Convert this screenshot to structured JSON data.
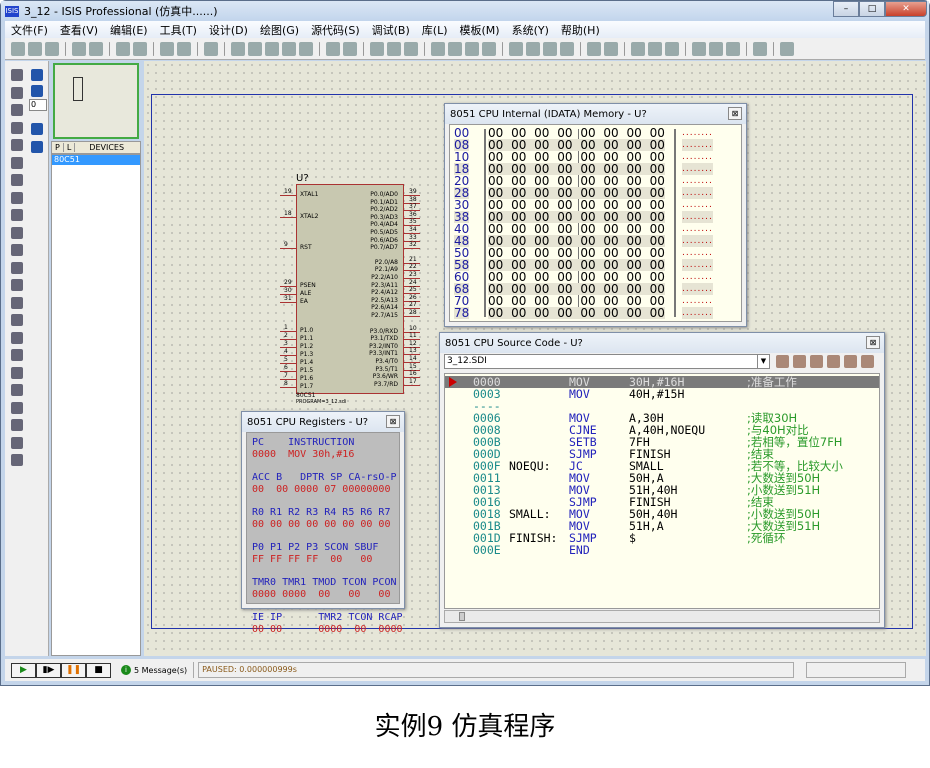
{
  "window": {
    "title": "3_12 - ISIS Professional (仿真中......)",
    "app_icon": "ISIS",
    "min": "–",
    "max": "□",
    "close": "✕"
  },
  "menu": [
    "文件(F)",
    "查看(V)",
    "编辑(E)",
    "工具(T)",
    "设计(D)",
    "绘图(G)",
    "源代码(S)",
    "调试(B)",
    "库(L)",
    "模板(M)",
    "系统(Y)",
    "帮助(H)"
  ],
  "toolbar_icons": [
    "new",
    "open",
    "save",
    "import",
    "export",
    "print",
    "print-area",
    "refresh",
    "grid",
    "origin",
    "pan",
    "zoom-in",
    "zoom-out",
    "zoom-all",
    "zoom-area",
    "undo",
    "redo",
    "cut",
    "copy",
    "paste",
    "block-copy",
    "block-move",
    "block-rotate",
    "block-delete",
    "pick",
    "make-device",
    "package",
    "decompose",
    "wire-autoroute",
    "search",
    "property-assign",
    "new-sheet",
    "remove-sheet",
    "goto-sheet",
    "export-netlist",
    "bill-of-materials",
    "electrical-check",
    "ares"
  ],
  "left_tools": {
    "rotate_value": "0"
  },
  "devices": {
    "tab_p": "P",
    "tab_l": "L",
    "header": "DEVICES",
    "items": [
      "80C51"
    ]
  },
  "chip": {
    "ref": "U?",
    "part": "80C51",
    "program": "PROGRAM=3_12.sdi",
    "left_pins": [
      [
        "19",
        "XTAL1"
      ],
      [
        "18",
        "XTAL2"
      ],
      [
        "9",
        "RST"
      ],
      [
        "29",
        "PSEN"
      ],
      [
        "30",
        "ALE"
      ],
      [
        "31",
        "EA"
      ],
      [
        "1",
        "P1.0"
      ],
      [
        "2",
        "P1.1"
      ],
      [
        "3",
        "P1.2"
      ],
      [
        "4",
        "P1.3"
      ],
      [
        "5",
        "P1.4"
      ],
      [
        "6",
        "P1.5"
      ],
      [
        "7",
        "P1.6"
      ],
      [
        "8",
        "P1.7"
      ]
    ],
    "right_pins": [
      [
        "39",
        "P0.0/AD0"
      ],
      [
        "38",
        "P0.1/AD1"
      ],
      [
        "37",
        "P0.2/AD2"
      ],
      [
        "36",
        "P0.3/AD3"
      ],
      [
        "35",
        "P0.4/AD4"
      ],
      [
        "34",
        "P0.5/AD5"
      ],
      [
        "33",
        "P0.6/AD6"
      ],
      [
        "32",
        "P0.7/AD7"
      ],
      [
        "21",
        "P2.0/A8"
      ],
      [
        "22",
        "P2.1/A9"
      ],
      [
        "23",
        "P2.2/A10"
      ],
      [
        "24",
        "P2.3/A11"
      ],
      [
        "25",
        "P2.4/A12"
      ],
      [
        "26",
        "P2.5/A13"
      ],
      [
        "27",
        "P2.6/A14"
      ],
      [
        "28",
        "P2.7/A15"
      ],
      [
        "10",
        "P3.0/RXD"
      ],
      [
        "11",
        "P3.1/TXD"
      ],
      [
        "12",
        "P3.2/INT0"
      ],
      [
        "13",
        "P3.3/INT1"
      ],
      [
        "14",
        "P3.4/T0"
      ],
      [
        "15",
        "P3.5/T1"
      ],
      [
        "16",
        "P3.6/WR"
      ],
      [
        "17",
        "P3.7/RD"
      ]
    ]
  },
  "memory": {
    "title": "8051 CPU Internal (IDATA) Memory - U?",
    "close": "⊠",
    "rows": [
      {
        "addr": "00",
        "bytes": "00 00 00 00 00 00 00 00",
        "ascii": "........"
      },
      {
        "addr": "08",
        "bytes": "00 00 00 00 00 00 00 00",
        "ascii": "........"
      },
      {
        "addr": "10",
        "bytes": "00 00 00 00 00 00 00 00",
        "ascii": "........"
      },
      {
        "addr": "18",
        "bytes": "00 00 00 00 00 00 00 00",
        "ascii": "........"
      },
      {
        "addr": "20",
        "bytes": "00 00 00 00 00 00 00 00",
        "ascii": "........"
      },
      {
        "addr": "28",
        "bytes": "00 00 00 00 00 00 00 00",
        "ascii": "........"
      },
      {
        "addr": "30",
        "bytes": "00 00 00 00 00 00 00 00",
        "ascii": "........"
      },
      {
        "addr": "38",
        "bytes": "00 00 00 00 00 00 00 00",
        "ascii": "........"
      },
      {
        "addr": "40",
        "bytes": "00 00 00 00 00 00 00 00",
        "ascii": "........"
      },
      {
        "addr": "48",
        "bytes": "00 00 00 00 00 00 00 00",
        "ascii": "........"
      },
      {
        "addr": "50",
        "bytes": "00 00 00 00 00 00 00 00",
        "ascii": "........"
      },
      {
        "addr": "58",
        "bytes": "00 00 00 00 00 00 00 00",
        "ascii": "........"
      },
      {
        "addr": "60",
        "bytes": "00 00 00 00 00 00 00 00",
        "ascii": "........"
      },
      {
        "addr": "68",
        "bytes": "00 00 00 00 00 00 00 00",
        "ascii": "........"
      },
      {
        "addr": "70",
        "bytes": "00 00 00 00 00 00 00 00",
        "ascii": "........"
      },
      {
        "addr": "78",
        "bytes": "00 00 00 00 00 00 00 00",
        "ascii": "........"
      }
    ]
  },
  "source": {
    "title": "8051 CPU Source Code - U?",
    "close": "⊠",
    "file": "3_12.SDI",
    "lines": [
      {
        "addr": "0000",
        "label": "",
        "op": "MOV",
        "args": "30H,#16H",
        "comment": ";准备工作",
        "current": true
      },
      {
        "addr": "0003",
        "label": "",
        "op": "MOV",
        "args": "40H,#15H",
        "comment": ""
      },
      {
        "addr": "----",
        "label": "",
        "op": "",
        "args": "",
        "comment": ""
      },
      {
        "addr": "0006",
        "label": "",
        "op": "MOV",
        "args": "A,30H",
        "comment": ";读取30H"
      },
      {
        "addr": "0008",
        "label": "",
        "op": "CJNE",
        "args": "A,40H,NOEQU",
        "comment": ";与40H对比"
      },
      {
        "addr": "000B",
        "label": "",
        "op": "SETB",
        "args": "7FH",
        "comment": ";若相等，置位7FH"
      },
      {
        "addr": "000D",
        "label": "",
        "op": "SJMP",
        "args": "FINISH",
        "comment": ";结束"
      },
      {
        "addr": "000F",
        "label": "NOEQU:",
        "op": "JC",
        "args": "SMALL",
        "comment": ";若不等，比较大小"
      },
      {
        "addr": "0011",
        "label": "",
        "op": "MOV",
        "args": "50H,A",
        "comment": ";大数送到50H"
      },
      {
        "addr": "0013",
        "label": "",
        "op": "MOV",
        "args": "51H,40H",
        "comment": ";小数送到51H"
      },
      {
        "addr": "0016",
        "label": "",
        "op": "SJMP",
        "args": "FINISH",
        "comment": ";结束"
      },
      {
        "addr": "0018",
        "label": "SMALL:",
        "op": "MOV",
        "args": "50H,40H",
        "comment": ";小数送到50H"
      },
      {
        "addr": "001B",
        "label": "",
        "op": "MOV",
        "args": "51H,A",
        "comment": ";大数送到51H"
      },
      {
        "addr": "001D",
        "label": "FINISH:",
        "op": "SJMP",
        "args": "$",
        "comment": ";死循环"
      },
      {
        "addr": "000E",
        "label": "",
        "op": "END",
        "args": "",
        "comment": ""
      }
    ]
  },
  "registers": {
    "title": "8051 CPU Registers - U?",
    "close": "⊠",
    "groups": [
      {
        "head": "PC    INSTRUCTION",
        "val": "0000  MOV 30h,#16"
      },
      {
        "head": "ACC B   DPTR SP CA-rsO-P",
        "val": "00  00 0000 07 00000000"
      },
      {
        "head": "R0 R1 R2 R3 R4 R5 R6 R7",
        "val": "00 00 00 00 00 00 00 00"
      },
      {
        "head": "P0 P1 P2 P3 SCON SBUF",
        "val": "FF FF FF FF  00   00"
      },
      {
        "head": "TMR0 TMR1 TMOD TCON PCON",
        "val": "0000 0000  00   00   00"
      },
      {
        "head": "IE IP      TMR2 TCON RCAP",
        "val": "00 00      0000  00  0000"
      }
    ]
  },
  "status": {
    "play": "▶",
    "step": "▮▶",
    "pause": "❚❚",
    "stop": "■",
    "messages": "5 Message(s)",
    "sim_status": "PAUSED: 0.000000999s"
  },
  "caption": "实例9  仿真程序"
}
